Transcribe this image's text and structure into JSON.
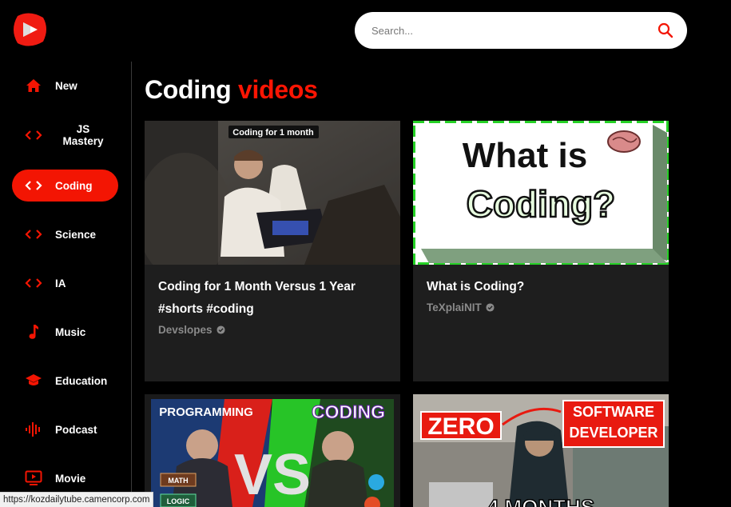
{
  "brand": {
    "accent_color": "#fc1503",
    "logo_icon": "youtube-play-logo-icon"
  },
  "search": {
    "placeholder": "Search...",
    "icon": "search-icon"
  },
  "sidebar": {
    "items": [
      {
        "label": "New",
        "icon": "home-icon",
        "active": false
      },
      {
        "label": "JS Mastery",
        "icon": "code-icon",
        "active": false
      },
      {
        "label": "Coding",
        "icon": "code-icon",
        "active": true
      },
      {
        "label": "Science",
        "icon": "code-icon",
        "active": false
      },
      {
        "label": "IA",
        "icon": "code-icon",
        "active": false
      },
      {
        "label": "Music",
        "icon": "music-note-icon",
        "active": false
      },
      {
        "label": "Education",
        "icon": "graduation-cap-icon",
        "active": false
      },
      {
        "label": "Podcast",
        "icon": "podcast-icon",
        "active": false
      },
      {
        "label": "Movie",
        "icon": "tv-icon",
        "active": false
      }
    ]
  },
  "feed": {
    "title_main": "Coding",
    "title_accent": "videos",
    "videos": [
      {
        "title": "Coding for 1 Month Versus 1 Year #shorts #coding",
        "channel": "Devslopes",
        "verified": true,
        "thumb_caption": "Coding for 1 month"
      },
      {
        "title": "What is Coding?",
        "channel": "TeXplaiNIT",
        "verified": true,
        "thumb_text_top": "What is",
        "thumb_text_bottom": "Coding?"
      },
      {
        "thumb_text_left": "PROGRAMMING",
        "thumb_text_right": "CODING",
        "thumb_text_mid": "VS",
        "thumb_tags": [
          "MATH",
          "LOGIC"
        ]
      },
      {
        "thumb_text_left": "ZERO",
        "thumb_text_right_1": "SOFTWARE",
        "thumb_text_right_2": "DEVELOPER",
        "thumb_text_bottom": "4 MONTHS"
      }
    ]
  },
  "status_bar": {
    "url": "https://kozdailytube.camencorp.com"
  }
}
